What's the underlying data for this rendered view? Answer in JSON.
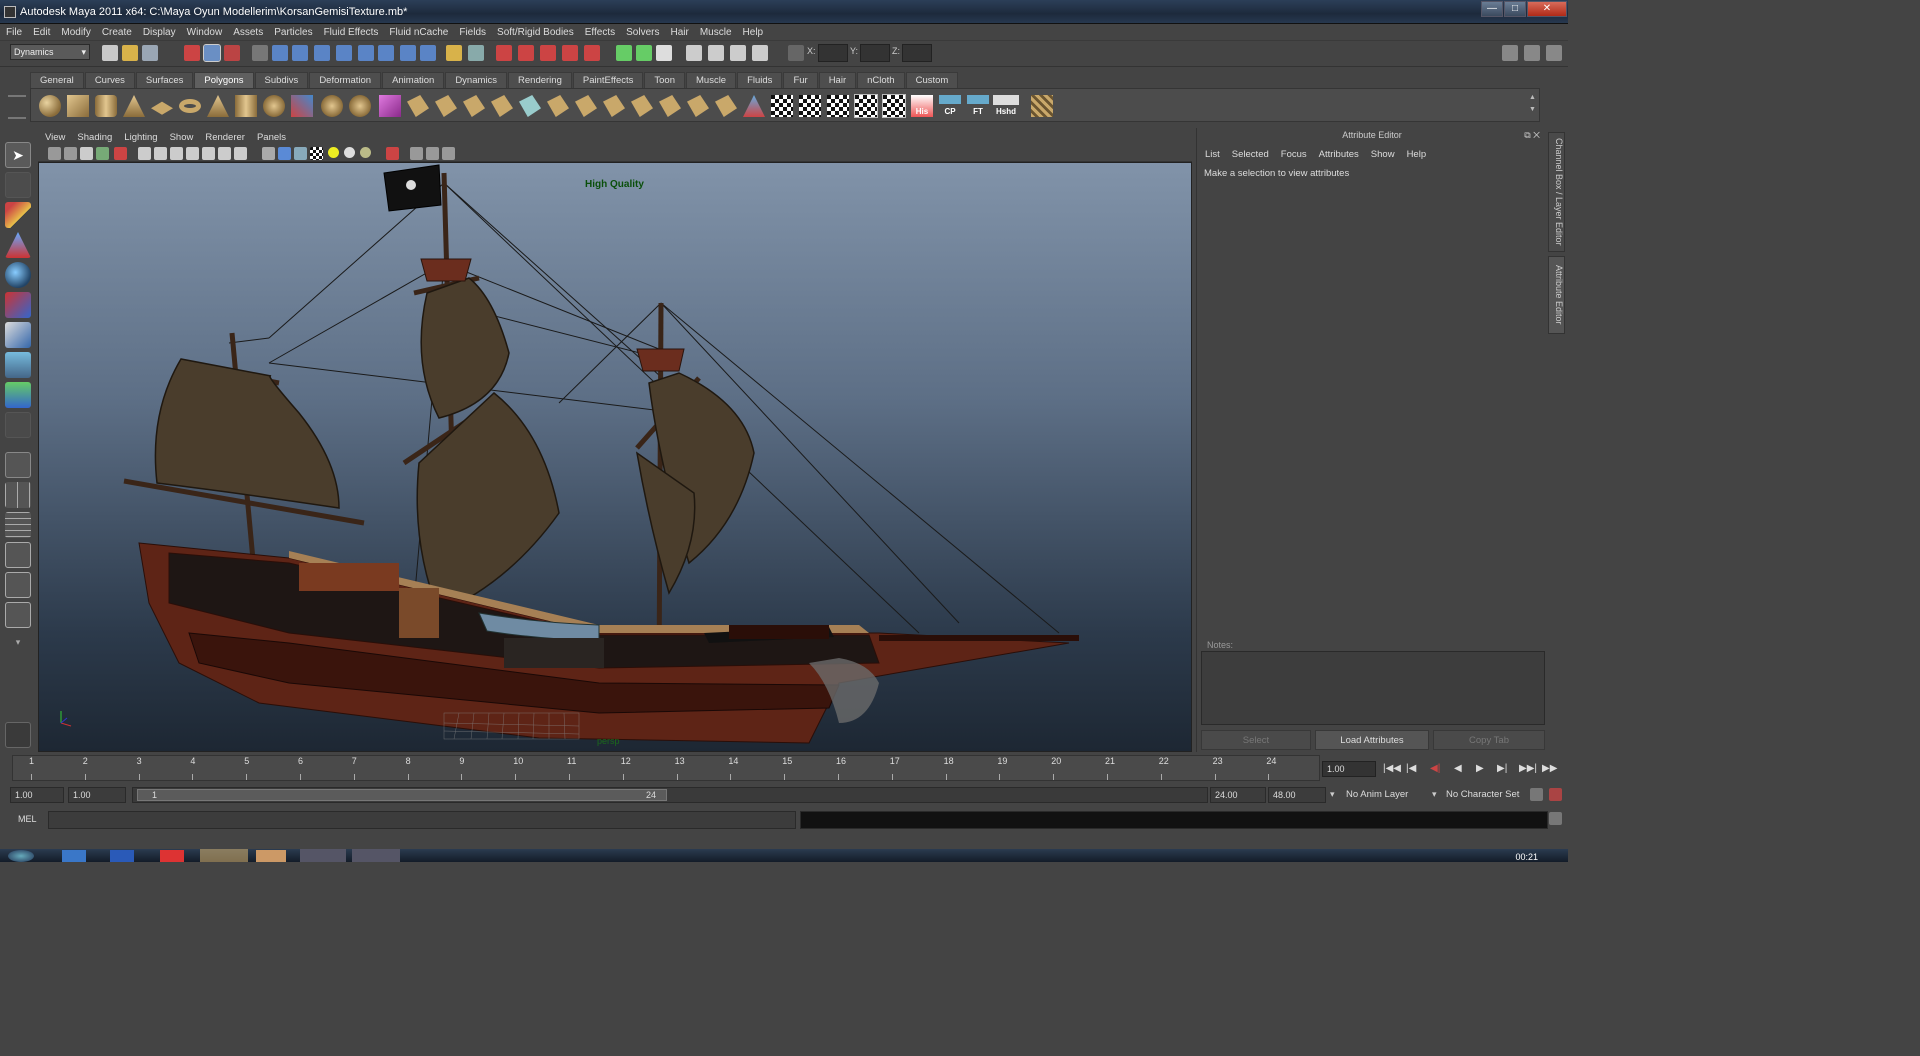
{
  "window": {
    "title": "Autodesk Maya 2011 x64: C:\\Maya Oyun Modellerim\\KorsanGemisiTexture.mb*",
    "minimize": "—",
    "maximize": "□",
    "close": "✕"
  },
  "menubar": [
    "File",
    "Edit",
    "Modify",
    "Create",
    "Display",
    "Window",
    "Assets",
    "Particles",
    "Fluid Effects",
    "Fluid nCache",
    "Fields",
    "Soft/Rigid Bodies",
    "Effects",
    "Solvers",
    "Hair",
    "Muscle",
    "Help"
  ],
  "statusline": {
    "menuset": "Dynamics",
    "x_label": "X:",
    "y_label": "Y:",
    "z_label": "Z:"
  },
  "shelf_tabs": [
    "General",
    "Curves",
    "Surfaces",
    "Polygons",
    "Subdivs",
    "Deformation",
    "Animation",
    "Dynamics",
    "Rendering",
    "PaintEffects",
    "Toon",
    "Muscle",
    "Fluids",
    "Fur",
    "Hair",
    "nCloth",
    "Custom"
  ],
  "shelf_active": "Polygons",
  "shelf_text_icons": [
    "His",
    "CP",
    "FT",
    "Hshd"
  ],
  "panel_menu": [
    "View",
    "Shading",
    "Lighting",
    "Show",
    "Renderer",
    "Panels"
  ],
  "viewport": {
    "hud_quality": "High Quality",
    "camera": "persp"
  },
  "attribute_editor": {
    "title": "Attribute Editor",
    "menu": [
      "List",
      "Selected",
      "Focus",
      "Attributes",
      "Show",
      "Help"
    ],
    "message": "Make a selection to view attributes",
    "notes_label": "Notes:",
    "buttons": {
      "select": "Select",
      "load": "Load Attributes",
      "copy": "Copy Tab"
    }
  },
  "side_tabs": {
    "channel_box": "Channel Box / Layer Editor",
    "attribute_editor": "Attribute Editor"
  },
  "timeslider": {
    "ticks": [
      "1",
      "2",
      "3",
      "4",
      "5",
      "6",
      "7",
      "8",
      "9",
      "10",
      "11",
      "12",
      "13",
      "14",
      "15",
      "16",
      "17",
      "18",
      "19",
      "20",
      "21",
      "22",
      "23",
      "24"
    ],
    "current_frame": "1.00",
    "playback": [
      "|◀◀",
      "|◀",
      "◀|",
      "◀",
      "▶",
      "▶|",
      "▶▶|",
      "▶▶"
    ]
  },
  "range": {
    "start": "1.00",
    "playback_start": "1.00",
    "slider_start": "1",
    "slider_end": "24",
    "playback_end": "24.00",
    "end": "48.00",
    "anim_layer": "No Anim Layer",
    "character_set": "No Character Set"
  },
  "cmdline": {
    "label": "MEL"
  },
  "taskbar": {
    "clock": "00:21"
  },
  "colors": {
    "accent_tab": "#5f5f5f",
    "hud_text": "#0a4f0a"
  }
}
